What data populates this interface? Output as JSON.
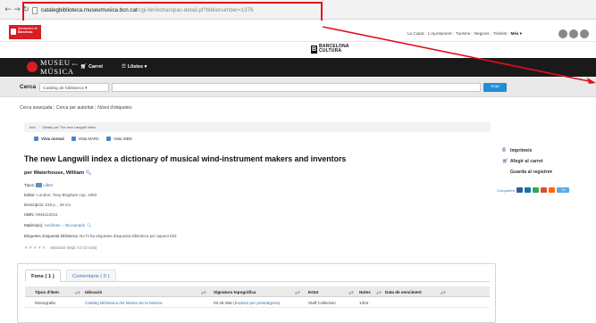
{
  "browser": {
    "back_icon": "left-arrow-icon",
    "forward_icon": "right-arrow-icon",
    "reload_icon": "reload-icon",
    "url_domain": "catalegbiblioteca.museumusica.bcn.cat",
    "url_path": "/cgi-bin/koha/opac-detail.pl?biblionumber=1376",
    "highlight_color": "#e0101e"
  },
  "city": {
    "logo_line1": "Ajuntament de",
    "logo_line2": "Barcelona",
    "links": [
      "La Ciutat",
      "L'Ajuntament",
      "Turisme",
      "Negocis",
      "Tràmits"
    ],
    "more": "Més",
    "brand_color": "#d81d23"
  },
  "culture": {
    "mark": "B",
    "line1": "BARCELONA",
    "line2": "CULTURA"
  },
  "navbar": {
    "logo_line1": "MUSEU",
    "logo_line2": "MÚSICA",
    "logo_small": "de la",
    "cart_label": "Carret",
    "lists_label": "Llistes"
  },
  "search": {
    "label": "Cerca",
    "select_value": "Catàleg de biblioteca",
    "input_value": "",
    "button_label": "Anar",
    "button_color": "#1f8ed6"
  },
  "adv_links": [
    "Cerca avançada",
    "Cerca per autoritat",
    "Núvol d'etiquetes"
  ],
  "breadcrumb": [
    "Inici",
    "Detalls per The new Langwill index"
  ],
  "views": [
    "Vista normal",
    "Vista MARC",
    "Vista ISBD"
  ],
  "record": {
    "title": "The new Langwill index a dictionary of musical wind-instrument makers and inventors",
    "author_prefix": "per",
    "author": "Waterhouse, William",
    "type_label": "Tipus:",
    "type_value": "Llibre",
    "publisher_label": "Editor:",
    "publisher_value": "London; Tony Bingham cop. 1993",
    "description_label": "Descripció:",
    "description_value": "518 p. ; 28 cm",
    "isbn_label": "ISBN:",
    "isbn_value": "0946113041",
    "subject_label": "Matèria(s):",
    "subject_value": "Aeròfons -- Diccionaris",
    "tags_label": "Etiquetes d'aquesta biblioteca:",
    "tags_value": "No hi ha etiquetes d'aquesta biblioteca per aquest títol.",
    "rating_text": "valoració mitja: 0.0 (0 vots)"
  },
  "actions": {
    "print": "Imprimeix",
    "cart": "Afegir al carret",
    "save": "Guarda al registre",
    "share_label": "Comparteix"
  },
  "holdings": {
    "tab_active": "Fons ( 1 )",
    "tab_comments": "Comentaris ( 0 )",
    "headers": [
      "Tipus d'ítem",
      "Ubicació",
      "Signatura topogràfica",
      "Estat",
      "Notes",
      "Data de venciment"
    ],
    "rows": [
      {
        "type": "Monografia",
        "location": "Catàleg Biblioteca del Museu de la Música",
        "callnumber": "03.46 Wat",
        "callnumber_link": "(Explora per prestatgeria)",
        "status": "Staff Collection",
        "notes": "1304",
        "due": ""
      }
    ]
  }
}
